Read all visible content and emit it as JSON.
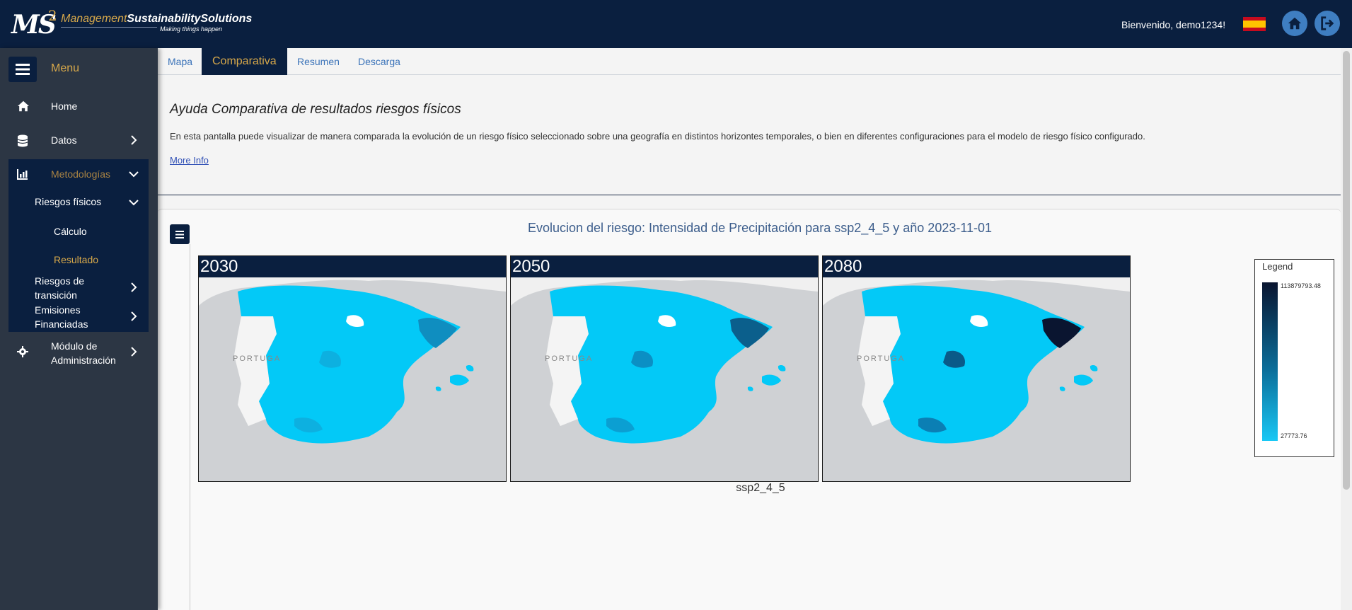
{
  "header": {
    "logo": {
      "ms": "MS",
      "two": "2",
      "brand_a": "Management",
      "brand_b": "Sustainability",
      "brand_c": "Solutions",
      "tagline": "Making things happen"
    },
    "welcome": "Bienvenido, demo1234!"
  },
  "sidebar": {
    "menu_label": "Menu",
    "items": [
      {
        "label": "Home"
      },
      {
        "label": "Datos"
      },
      {
        "label": "Metodologías"
      },
      {
        "label": "Módulo de Administración"
      }
    ],
    "sub": {
      "riesgos_fisicos": "Riesgos físicos",
      "calculo": "Cálculo",
      "resultado": "Resultado",
      "transicion": "Riesgos de transición",
      "emisiones": "Emisiones Financiadas"
    }
  },
  "tabs": [
    {
      "label": "Mapa"
    },
    {
      "label": "Comparativa"
    },
    {
      "label": "Resumen"
    },
    {
      "label": "Descarga"
    }
  ],
  "help": {
    "title": "Ayuda Comparativa de resultados riesgos físicos",
    "text": "En esta pantalla puede visualizar de manera comparada la evolución de un riesgo físico seleccionado sobre una geografía en distintos horizontes temporales, o bien en diferentes configuraciones para el modelo de riesgo físico configurado.",
    "more_info": "More Info"
  },
  "chart": {
    "title": "Evolucion del riesgo: Intensidad de Precipitación para ssp2_4_5 y año 2023-11-01",
    "panels": [
      {
        "year": "2030",
        "portugal": "PORTUGA"
      },
      {
        "year": "2050",
        "portugal": "PORTUGA"
      },
      {
        "year": "2080",
        "portugal": "PORTUGA"
      }
    ],
    "scenario": "ssp2_4_5",
    "legend": {
      "title": "Legend",
      "max": "113879793.48",
      "min": "27773.76"
    }
  },
  "colors": {
    "navy": "#0a1f3f",
    "gold": "#d7a84a",
    "cyan": "#19c8f5",
    "accent_blue": "#3f7ec1"
  }
}
